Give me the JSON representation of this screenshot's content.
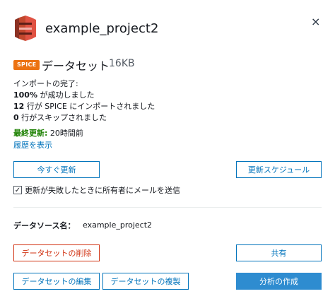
{
  "header": {
    "title": "example_project2",
    "logo_icon": "s3-bucket-icon",
    "close_glyph": "×"
  },
  "dataset": {
    "badge": "SPICE",
    "label": "データセット",
    "size": "16KB"
  },
  "import": {
    "heading": "インポートの完了:",
    "success_pct": "100%",
    "success_text": " が成功しました",
    "rows_count": "12",
    "rows_text": " 行が SPICE にインポートされました",
    "skipped_count": "0",
    "skipped_text": " 行がスキップされました"
  },
  "updated": {
    "label": "最終更新:",
    "value": " 20時間前"
  },
  "history_link": "履歴を表示",
  "buttons": {
    "refresh_now": "今すぐ更新",
    "refresh_schedule": "更新スケジュール",
    "delete": "データセットの削除",
    "share": "共有",
    "edit": "データセットの編集",
    "duplicate": "データセットの複製",
    "create_analysis": "分析の作成"
  },
  "notify": {
    "checked": true,
    "check_glyph": "✓",
    "label": "更新が失敗したときに所有者にメールを送信"
  },
  "source": {
    "label": "データソース名：",
    "value": "example_project2"
  },
  "colors": {
    "accent": "#0073bb",
    "danger": "#d13212",
    "success": "#1d8102",
    "spice_badge": "#ec7211",
    "primary_button": "#2e8cd0"
  }
}
